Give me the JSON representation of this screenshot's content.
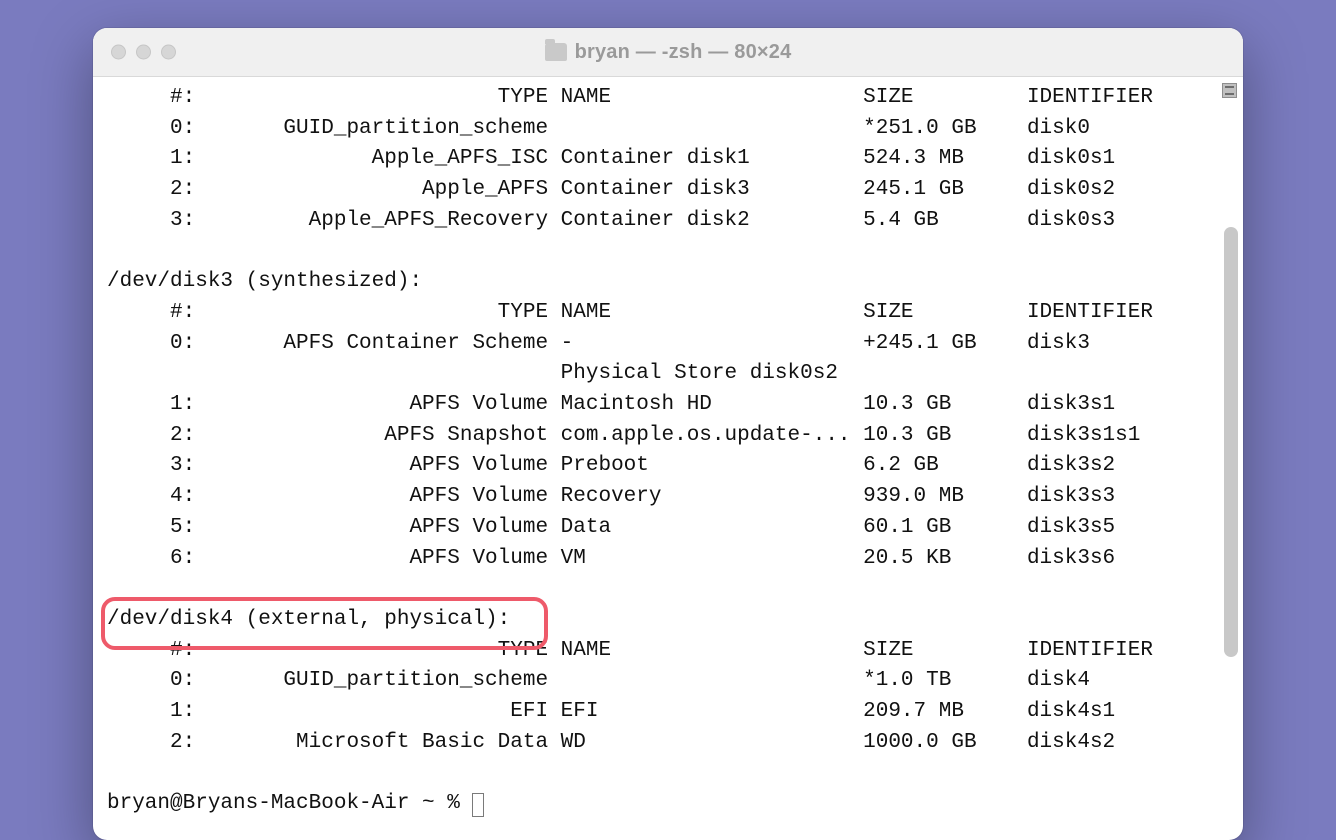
{
  "window": {
    "title": "bryan — -zsh — 80×24"
  },
  "highlight": {
    "text": "/dev/disk4 (external, physical):"
  },
  "prompt": "bryan@Bryans-MacBook-Air ~ % ",
  "diskutil": {
    "header_cols": [
      "#",
      "TYPE",
      "NAME",
      "SIZE",
      "IDENTIFIER"
    ],
    "disks": [
      {
        "device": null,
        "rows": [
          {
            "num": "#:",
            "type": "TYPE",
            "name": "NAME",
            "size": "SIZE",
            "identifier": "IDENTIFIER",
            "is_header": true
          },
          {
            "num": "0:",
            "type": "GUID_partition_scheme",
            "name": "",
            "size": "*251.0 GB",
            "identifier": "disk0"
          },
          {
            "num": "1:",
            "type": "Apple_APFS_ISC",
            "name": "Container disk1",
            "size": "524.3 MB",
            "identifier": "disk0s1"
          },
          {
            "num": "2:",
            "type": "Apple_APFS",
            "name": "Container disk3",
            "size": "245.1 GB",
            "identifier": "disk0s2"
          },
          {
            "num": "3:",
            "type": "Apple_APFS_Recovery",
            "name": "Container disk2",
            "size": "5.4 GB",
            "identifier": "disk0s3"
          }
        ]
      },
      {
        "device": "/dev/disk3 (synthesized):",
        "rows": [
          {
            "num": "#:",
            "type": "TYPE",
            "name": "NAME",
            "size": "SIZE",
            "identifier": "IDENTIFIER",
            "is_header": true
          },
          {
            "num": "0:",
            "type": "APFS Container Scheme",
            "name": "-",
            "size": "+245.1 GB",
            "identifier": "disk3"
          },
          {
            "num": "",
            "type": "",
            "name": "Physical Store disk0s2",
            "size": "",
            "identifier": ""
          },
          {
            "num": "1:",
            "type": "APFS Volume",
            "name": "Macintosh HD",
            "size": "10.3 GB",
            "identifier": "disk3s1"
          },
          {
            "num": "2:",
            "type": "APFS Snapshot",
            "name": "com.apple.os.update-...",
            "size": "10.3 GB",
            "identifier": "disk3s1s1"
          },
          {
            "num": "3:",
            "type": "APFS Volume",
            "name": "Preboot",
            "size": "6.2 GB",
            "identifier": "disk3s2"
          },
          {
            "num": "4:",
            "type": "APFS Volume",
            "name": "Recovery",
            "size": "939.0 MB",
            "identifier": "disk3s3"
          },
          {
            "num": "5:",
            "type": "APFS Volume",
            "name": "Data",
            "size": "60.1 GB",
            "identifier": "disk3s5"
          },
          {
            "num": "6:",
            "type": "APFS Volume",
            "name": "VM",
            "size": "20.5 KB",
            "identifier": "disk3s6"
          }
        ]
      },
      {
        "device": "/dev/disk4 (external, physical):",
        "highlight": true,
        "rows": [
          {
            "num": "#:",
            "type": "TYPE",
            "name": "NAME",
            "size": "SIZE",
            "identifier": "IDENTIFIER",
            "is_header": true
          },
          {
            "num": "0:",
            "type": "GUID_partition_scheme",
            "name": "",
            "size": "*1.0 TB",
            "identifier": "disk4"
          },
          {
            "num": "1:",
            "type": "EFI",
            "name": "EFI",
            "size": "209.7 MB",
            "identifier": "disk4s1"
          },
          {
            "num": "2:",
            "type": "Microsoft Basic Data",
            "name": "WD",
            "size": "1000.0 GB",
            "identifier": "disk4s2"
          }
        ]
      }
    ]
  }
}
